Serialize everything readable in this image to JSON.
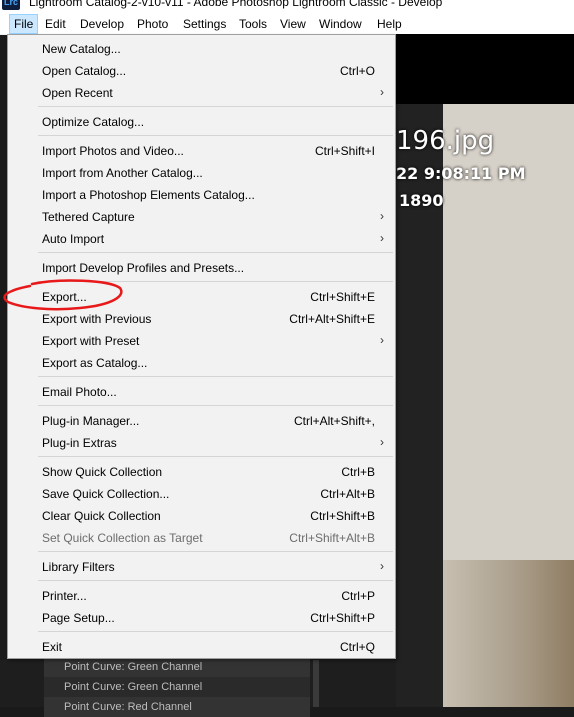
{
  "window": {
    "app_icon": "Lrc",
    "title": "Lightroom Catalog-2-v10-v11 - Adobe Photoshop Lightroom Classic - Develop"
  },
  "menubar": [
    "File",
    "Edit",
    "Develop",
    "Photo",
    "Settings",
    "Tools",
    "View",
    "Window",
    "Help"
  ],
  "file_menu": {
    "new_catalog": {
      "label": "New Catalog...",
      "shortcut": ""
    },
    "open_catalog": {
      "label": "Open Catalog...",
      "shortcut": "Ctrl+O"
    },
    "open_recent": {
      "label": "Open Recent",
      "shortcut": ""
    },
    "optimize_catalog": {
      "label": "Optimize Catalog...",
      "shortcut": ""
    },
    "import_photos": {
      "label": "Import Photos and Video...",
      "shortcut": "Ctrl+Shift+I"
    },
    "import_catalog": {
      "label": "Import from Another Catalog...",
      "shortcut": ""
    },
    "import_pse": {
      "label": "Import a Photoshop Elements Catalog...",
      "shortcut": ""
    },
    "tethered_capture": {
      "label": "Tethered Capture",
      "shortcut": ""
    },
    "auto_import": {
      "label": "Auto Import",
      "shortcut": ""
    },
    "import_profiles": {
      "label": "Import Develop Profiles and Presets...",
      "shortcut": ""
    },
    "export": {
      "label": "Export...",
      "shortcut": "Ctrl+Shift+E"
    },
    "export_previous": {
      "label": "Export with Previous",
      "shortcut": "Ctrl+Alt+Shift+E"
    },
    "export_preset": {
      "label": "Export with Preset",
      "shortcut": ""
    },
    "export_catalog": {
      "label": "Export as Catalog...",
      "shortcut": ""
    },
    "email_photo": {
      "label": "Email Photo...",
      "shortcut": ""
    },
    "plugin_manager": {
      "label": "Plug-in Manager...",
      "shortcut": "Ctrl+Alt+Shift+,"
    },
    "plugin_extras": {
      "label": "Plug-in Extras",
      "shortcut": ""
    },
    "show_quick": {
      "label": "Show Quick Collection",
      "shortcut": "Ctrl+B"
    },
    "save_quick": {
      "label": "Save Quick Collection...",
      "shortcut": "Ctrl+Alt+B"
    },
    "clear_quick": {
      "label": "Clear Quick Collection",
      "shortcut": "Ctrl+Shift+B"
    },
    "set_quick_target": {
      "label": "Set Quick Collection as Target",
      "shortcut": "Ctrl+Shift+Alt+B"
    },
    "library_filters": {
      "label": "Library Filters",
      "shortcut": ""
    },
    "printer": {
      "label": "Printer...",
      "shortcut": "Ctrl+P"
    },
    "page_setup": {
      "label": "Page Setup...",
      "shortcut": "Ctrl+Shift+P"
    },
    "exit": {
      "label": "Exit",
      "shortcut": "Ctrl+Q"
    }
  },
  "submenu_glyph": "›",
  "photo_overlay": {
    "filename": "196.jpg",
    "datetime": "22 9:08:11 PM",
    "dims": "1890"
  },
  "history_panel": [
    "Point Curve: Green Channel",
    "Point Curve: Green Channel",
    "Point Curve: Red Channel"
  ],
  "colors": {
    "menu_bg": "#f2f2f2",
    "menubar_active": "#cce8ff",
    "annotation": "#e8191a"
  }
}
